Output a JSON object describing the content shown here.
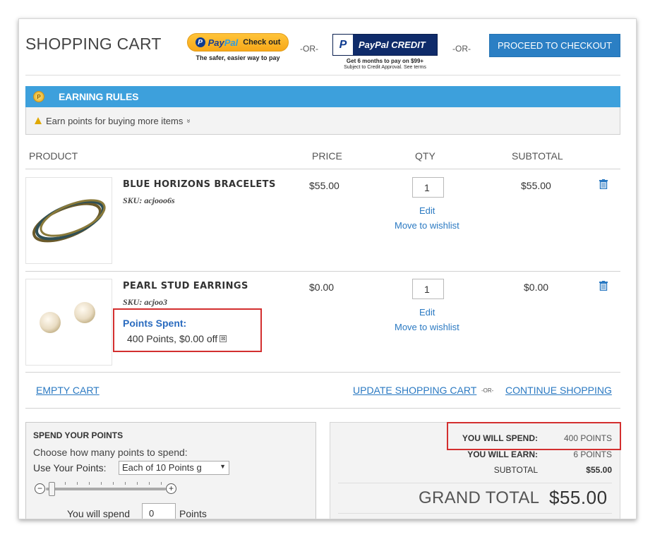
{
  "header": {
    "title": "SHOPPING CART",
    "paypal_checkout": {
      "brand_pay": "Pay",
      "brand_pal": "Pal",
      "action": "Check out",
      "tagline": "The safer, easier way to pay"
    },
    "or_label": "-OR-",
    "paypal_credit": {
      "label": "PayPal CREDIT",
      "tagline_1": "Get 6 months to pay on $99+",
      "tagline_2": "Subject to Credit Approval. See terms"
    },
    "checkout_label": "PROCEED TO CHECKOUT"
  },
  "earning_rules": {
    "title": "EARNING RULES",
    "message": "Earn points for buying more items",
    "expand_glyph": "»"
  },
  "table": {
    "columns": [
      "PRODUCT",
      "PRICE",
      "QTY",
      "SUBTOTAL"
    ],
    "rows": [
      {
        "name": "BLUE HORIZONS BRACELETS",
        "sku": "SKU: acjooo6s",
        "price": "$55.00",
        "qty": "1",
        "edit": "Edit",
        "wishlist": "Move to wishlist",
        "subtotal": "$55.00",
        "image": "bangle-bracelets"
      },
      {
        "name": "PEARL STUD EARRINGS",
        "sku": "SKU: acjoo3",
        "price": "$0.00",
        "qty": "1",
        "edit": "Edit",
        "wishlist": "Move to wishlist",
        "subtotal": "$0.00",
        "image": "pearl-earrings",
        "points_spent_label": "Points Spent:",
        "points_spent_value": "400 Points, $0.00 off",
        "remove_glyph": "⊠"
      }
    ]
  },
  "actions": {
    "empty_cart": "EMPTY CART",
    "update_cart": "UPDATE SHOPPING CART",
    "or_small": "-OR-",
    "continue_shopping": "CONTINUE SHOPPING"
  },
  "spend_points": {
    "title": "SPEND YOUR POINTS",
    "description": "Choose how many points to spend:",
    "use_label": "Use Your Points:",
    "select_value": "Each of 10 Points g",
    "minus": "−",
    "plus": "+",
    "slider_position": 0,
    "spend_label": "You will spend",
    "spend_value": "0",
    "points_label": "Points"
  },
  "totals": {
    "spend_label": "YOU WILL SPEND:",
    "spend_value": "400 POINTS",
    "earn_label": "YOU WILL EARN:",
    "earn_value": "6 POINTS",
    "subtotal_label": "SUBTOTAL",
    "subtotal_value": "$55.00",
    "grand_total_label": "GRAND TOTAL",
    "grand_total_value": "$55.00"
  },
  "colors": {
    "accent_blue": "#3da0dc",
    "link_blue": "#2a79c2",
    "checkout_blue": "#2b7fc4",
    "highlight_red": "#d32f2f",
    "paypal_yellow": "#ffc43a",
    "paypal_navy": "#0f2b6a"
  }
}
